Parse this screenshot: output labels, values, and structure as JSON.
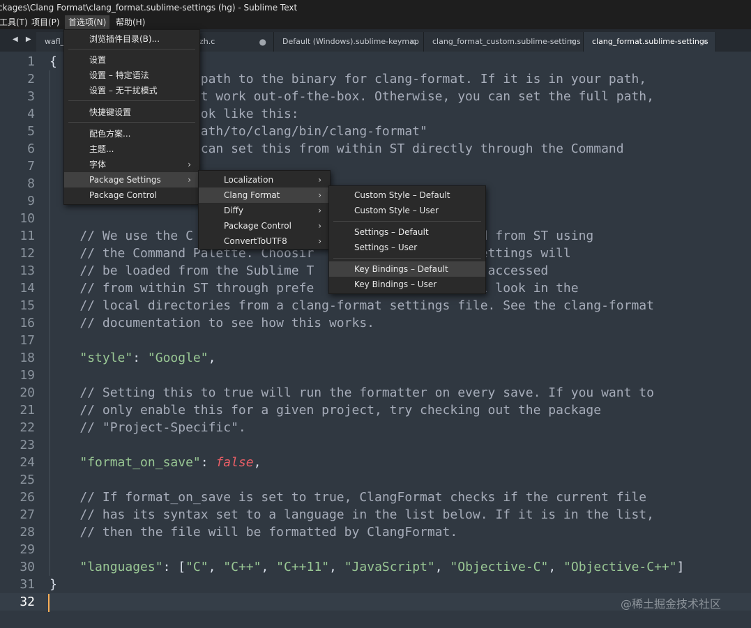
{
  "window": {
    "title": "ckages\\Clang Format\\clang_format.sublime-settings (hg) - Sublime Text"
  },
  "menubar": {
    "items": [
      "工具(T)",
      "项目(P)",
      "首选项(N)",
      "帮助(H)"
    ]
  },
  "tabs": [
    {
      "label": "wafl_r",
      "close": ""
    },
    {
      "label": "zh.c",
      "close": "●"
    },
    {
      "label": "Default (Windows).sublime-keymap",
      "close": "×"
    },
    {
      "label": "clang_format_custom.sublime-settings",
      "close": "×"
    },
    {
      "label": "clang_format.sublime-settings",
      "close": "×"
    }
  ],
  "nav_arrows": "◀ ▶",
  "editor": {
    "current_line": 32,
    "lines": [
      {
        "n": "1",
        "t": [
          {
            "c": "p",
            "s": "{"
          }
        ]
      },
      {
        "n": "2",
        "t": [
          {
            "c": "c",
            "s": "                    path to the binary for clang-format. If it is in your path,"
          }
        ]
      },
      {
        "n": "3",
        "t": [
          {
            "c": "c",
            "s": "                   st work out-of-the-box. Otherwise, you can set the full path,"
          }
        ]
      },
      {
        "n": "4",
        "t": [
          {
            "c": "c",
            "s": "                   ook like this:"
          }
        ]
      },
      {
        "n": "5",
        "t": [
          {
            "c": "c",
            "s": "                 \"/path/to/clang/bin/clang-format\""
          }
        ]
      },
      {
        "n": "6",
        "t": [
          {
            "c": "c",
            "s": "                  u can set this from within ST directly through the Command"
          }
        ]
      },
      {
        "n": "7",
        "t": [
          {
            "c": "p",
            "s": ""
          }
        ]
      },
      {
        "n": "8",
        "t": [
          {
            "c": "p",
            "s": ""
          }
        ]
      },
      {
        "n": "9",
        "t": [
          {
            "c": "p",
            "s": ""
          }
        ]
      },
      {
        "n": "10",
        "t": [
          {
            "c": "p",
            "s": ""
          }
        ]
      },
      {
        "n": "11",
        "t": [
          {
            "c": "c",
            "s": "    // We use the C                               selected from ST using"
          }
        ]
      },
      {
        "n": "12",
        "t": [
          {
            "c": "c",
            "s": "    // the Command Palette. Choosir              at the settings will"
          }
        ]
      },
      {
        "n": "13",
        "t": [
          {
            "c": "c",
            "s": "    // be loaded from the Sublime T              which is accessed"
          }
        ]
      },
      {
        "n": "14",
        "t": [
          {
            "c": "c",
            "s": "    // from within ST through prefe              ile' will look in the"
          }
        ]
      },
      {
        "n": "15",
        "t": [
          {
            "c": "c",
            "s": "    // local directories from a clang-format settings file. See the clang-format"
          }
        ]
      },
      {
        "n": "16",
        "t": [
          {
            "c": "c",
            "s": "    // documentation to see how this works."
          }
        ]
      },
      {
        "n": "17",
        "t": [
          {
            "c": "p",
            "s": ""
          }
        ]
      },
      {
        "n": "18",
        "t": [
          {
            "c": "p",
            "s": "    "
          },
          {
            "c": "s",
            "s": "\"style\""
          },
          {
            "c": "p",
            "s": ": "
          },
          {
            "c": "s",
            "s": "\"Google\""
          },
          {
            "c": "p",
            "s": ","
          }
        ]
      },
      {
        "n": "19",
        "t": [
          {
            "c": "p",
            "s": ""
          }
        ]
      },
      {
        "n": "20",
        "t": [
          {
            "c": "c",
            "s": "    // Setting this to true will run the formatter on every save. If you want to"
          }
        ]
      },
      {
        "n": "21",
        "t": [
          {
            "c": "c",
            "s": "    // only enable this for a given project, try checking out the package"
          }
        ]
      },
      {
        "n": "22",
        "t": [
          {
            "c": "c",
            "s": "    // \"Project-Specific\"."
          }
        ]
      },
      {
        "n": "23",
        "t": [
          {
            "c": "p",
            "s": ""
          }
        ]
      },
      {
        "n": "24",
        "t": [
          {
            "c": "p",
            "s": "    "
          },
          {
            "c": "s",
            "s": "\"format_on_save\""
          },
          {
            "c": "p",
            "s": ": "
          },
          {
            "c": "b",
            "s": "false"
          },
          {
            "c": "p",
            "s": ","
          }
        ]
      },
      {
        "n": "25",
        "t": [
          {
            "c": "p",
            "s": ""
          }
        ]
      },
      {
        "n": "26",
        "t": [
          {
            "c": "c",
            "s": "    // If format_on_save is set to true, ClangFormat checks if the current file"
          }
        ]
      },
      {
        "n": "27",
        "t": [
          {
            "c": "c",
            "s": "    // has its syntax set to a language in the list below. If it is in the list,"
          }
        ]
      },
      {
        "n": "28",
        "t": [
          {
            "c": "c",
            "s": "    // then the file will be formatted by ClangFormat."
          }
        ]
      },
      {
        "n": "29",
        "t": [
          {
            "c": "p",
            "s": ""
          }
        ]
      },
      {
        "n": "30",
        "t": [
          {
            "c": "p",
            "s": "    "
          },
          {
            "c": "s",
            "s": "\"languages\""
          },
          {
            "c": "p",
            "s": ": ["
          },
          {
            "c": "s",
            "s": "\"C\""
          },
          {
            "c": "p",
            "s": ", "
          },
          {
            "c": "s",
            "s": "\"C++\""
          },
          {
            "c": "p",
            "s": ", "
          },
          {
            "c": "s",
            "s": "\"C++11\""
          },
          {
            "c": "p",
            "s": ", "
          },
          {
            "c": "s",
            "s": "\"JavaScript\""
          },
          {
            "c": "p",
            "s": ", "
          },
          {
            "c": "s",
            "s": "\"Objective-C\""
          },
          {
            "c": "p",
            "s": ", "
          },
          {
            "c": "s",
            "s": "\"Objective-C++\""
          },
          {
            "c": "p",
            "s": "]"
          }
        ]
      },
      {
        "n": "31",
        "t": [
          {
            "c": "p",
            "s": "}"
          }
        ]
      },
      {
        "n": "32",
        "t": [
          {
            "c": "p",
            "s": ""
          }
        ]
      }
    ]
  },
  "prefs_menu": [
    {
      "label": "浏览插件目录(B)...",
      "arrow": ""
    },
    {
      "label": "设置",
      "arrow": ""
    },
    {
      "label": "设置 – 特定语法",
      "arrow": ""
    },
    {
      "label": "设置 – 无干扰模式",
      "arrow": ""
    },
    {
      "label": "快捷键设置",
      "arrow": ""
    },
    {
      "label": "配色方案...",
      "arrow": ""
    },
    {
      "label": "主题...",
      "arrow": ""
    },
    {
      "label": "字体",
      "arrow": "›"
    },
    {
      "label": "Package Settings",
      "arrow": "›"
    },
    {
      "label": "Package Control",
      "arrow": ""
    }
  ],
  "package_settings_menu": [
    {
      "label": "Localization",
      "arrow": "›"
    },
    {
      "label": "Clang Format",
      "arrow": "›"
    },
    {
      "label": "Diffy",
      "arrow": "›"
    },
    {
      "label": "Package Control",
      "arrow": "›"
    },
    {
      "label": "ConvertToUTF8",
      "arrow": "›"
    }
  ],
  "clang_format_menu": [
    {
      "label": "Custom Style – Default",
      "arrow": ""
    },
    {
      "label": "Custom Style – User",
      "arrow": ""
    },
    {
      "label": "Settings – Default",
      "arrow": ""
    },
    {
      "label": "Settings – User",
      "arrow": ""
    },
    {
      "label": "Key Bindings – Default",
      "arrow": ""
    },
    {
      "label": "Key Bindings – User",
      "arrow": ""
    }
  ],
  "watermark": "@稀土掘金技术社区",
  "colors": {
    "background": "#303841",
    "comment": "#a6acb9",
    "string": "#99c794",
    "boolean": "#ec5f67",
    "caret": "#f9ae58"
  }
}
